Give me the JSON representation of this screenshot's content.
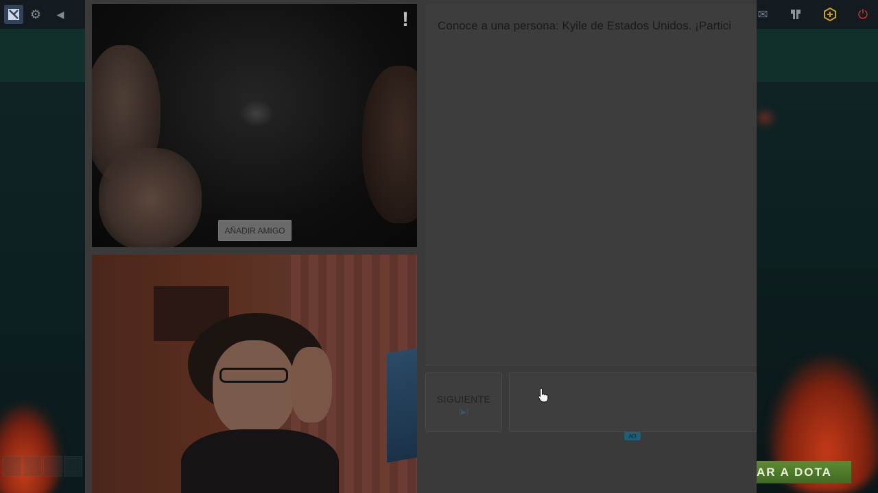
{
  "topbar": {
    "icons": [
      "dota-logo-icon",
      "gear-icon",
      "back-arrow-icon",
      "mail-icon",
      "armory-icon",
      "plus-icon",
      "power-icon"
    ]
  },
  "video": {
    "report_symbol": "!",
    "add_friend_label": "AÑADIR AMIGO"
  },
  "chat": {
    "message": "Conoce a una persona: Kyile de Estados Unidos. ¡Partici"
  },
  "controls": {
    "next_label": "SIGUIENTE",
    "next_key_hint": "(▶)",
    "ad_label": "AD"
  },
  "game": {
    "play_label": "AR A DOTA"
  },
  "colors": {
    "play_button": "#5f8a33",
    "power_icon": "#d8371d",
    "plus_icon": "#c9a31a"
  }
}
